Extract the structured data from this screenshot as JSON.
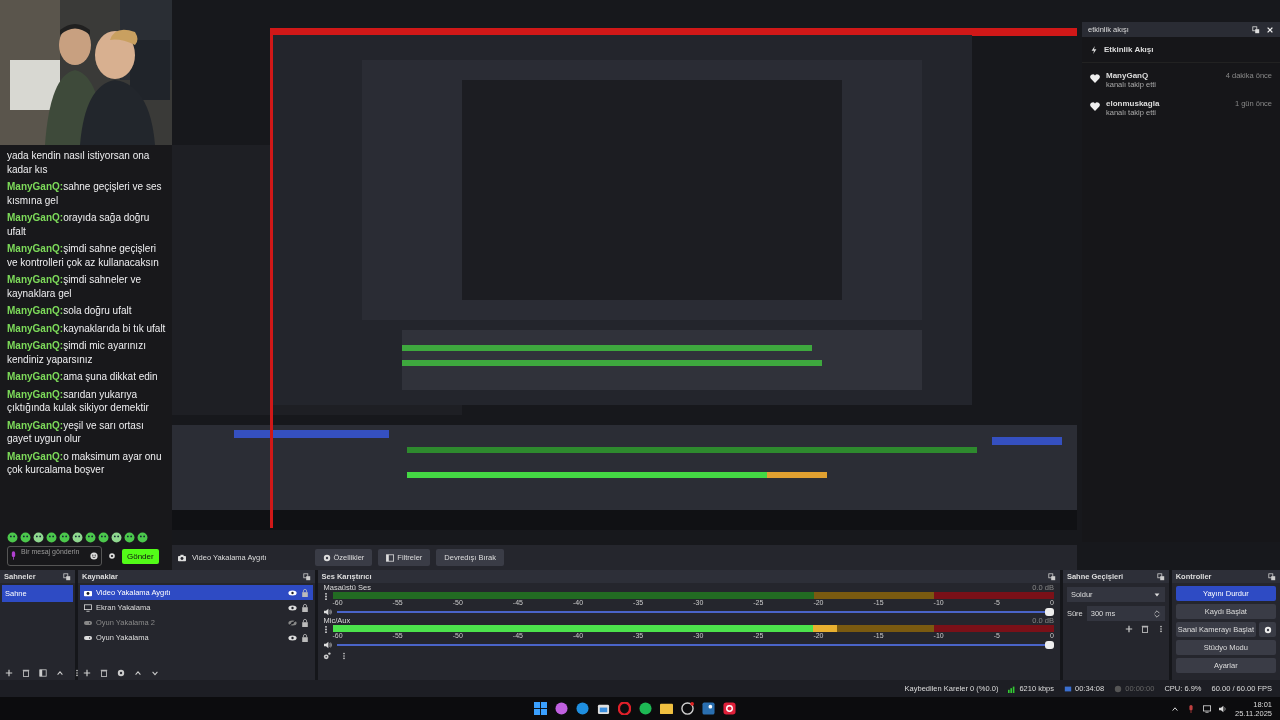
{
  "chat": {
    "messages": [
      {
        "text": "yada kendin nasıl istiyorsan ona kadar kıs"
      },
      {
        "user": "ManyGanQ:",
        "text": "sahne geçişleri ve ses kısmına gel"
      },
      {
        "user": "ManyGanQ:",
        "text": "orayıda sağa doğru ufalt"
      },
      {
        "user": "ManyGanQ:",
        "text": "şimdi sahne geçişleri ve kontrolleri çok az kullanacaksın"
      },
      {
        "user": "ManyGanQ:",
        "text": "şimdi sahneler ve kaynaklara gel"
      },
      {
        "user": "ManyGanQ:",
        "text": "sola doğru ufalt"
      },
      {
        "user": "ManyGanQ:",
        "text": "kaynaklarıda bi tık ufalt"
      },
      {
        "user": "ManyGanQ:",
        "text": "şimdi mic ayarınızı kendiniz yaparsınız"
      },
      {
        "user": "ManyGanQ:",
        "text": "ama şuna dikkat edin"
      },
      {
        "user": "ManyGanQ:",
        "text": "sarıdan yukarıya çıktığında kulak sikiyor demektir"
      },
      {
        "user": "ManyGanQ:",
        "text": "yeşil ve sarı ortası gayet uygun olur"
      },
      {
        "user": "ManyGanQ:",
        "text": "o maksimum ayar onu çok kurcalama boşver"
      }
    ],
    "input": {
      "placeholder": "Bir mesaj gönderin"
    },
    "send_button": "Gönder"
  },
  "source_toolbar": {
    "source": "Video Yakalama Aygıtı",
    "buttons": [
      "Özellikler",
      "Filtreler",
      "Devredışı Bırak"
    ]
  },
  "activity_dock": {
    "title": "etkinlik akışı",
    "heading": "Etkinlik Akışı",
    "events": [
      {
        "user": "ManyGanQ",
        "action": "kanalı takip etti",
        "time": "4 dakika önce"
      },
      {
        "user": "elonmuskagla",
        "action": "kanalı takip etti",
        "time": "1 gün önce"
      }
    ]
  },
  "scenes": {
    "title": "Sahneler",
    "items": [
      {
        "name": "Sahne",
        "selected": true
      }
    ]
  },
  "sources": {
    "title": "Kaynaklar",
    "items": [
      {
        "name": "Video Yakalama Aygıtı",
        "kind": "camera",
        "selected": true,
        "visible": true
      },
      {
        "name": "Ekran Yakalama",
        "kind": "display",
        "selected": false,
        "visible": true
      },
      {
        "name": "Oyun Yakalama 2",
        "kind": "game",
        "selected": false,
        "visible": false
      },
      {
        "name": "Oyun Yakalama",
        "kind": "game",
        "selected": false,
        "visible": true
      }
    ]
  },
  "mixer": {
    "title": "Ses Karıştırıcı",
    "channels": [
      {
        "name": "Masaüstü Ses",
        "reading": "0.0 dB",
        "meter": {
          "level": 0
        },
        "fader": {
          "level": 1
        },
        "scale": [
          "-60",
          "-55",
          "-50",
          "-45",
          "-40",
          "-35",
          "-30",
          "-25",
          "-20",
          "-15",
          "-10",
          "-5",
          "0"
        ]
      },
      {
        "name": "Mic/Aux",
        "reading": "0.0 dB",
        "meter": {
          "level": 0.7
        },
        "fader": {
          "level": 1
        },
        "scale": [
          "-60",
          "-55",
          "-50",
          "-45",
          "-40",
          "-35",
          "-30",
          "-25",
          "-20",
          "-15",
          "-10",
          "-5",
          "0"
        ]
      }
    ]
  },
  "transitions": {
    "title": "Sahne Geçişleri",
    "transition": "Soldur",
    "duration_label": "Süre",
    "duration": "300 ms"
  },
  "controls": {
    "title": "Kontroller",
    "buttons": [
      {
        "label": "Yayını Durdur",
        "active": true,
        "settings": false
      },
      {
        "label": "Kaydı Başlat",
        "active": false,
        "settings": false
      },
      {
        "label": "Sanal Kamerayı Başlat",
        "active": false,
        "settings": true
      },
      {
        "label": "Stüdyo Modu",
        "active": false,
        "settings": false
      },
      {
        "label": "Ayarlar",
        "active": false,
        "settings": false
      }
    ]
  },
  "status_bar": {
    "dropped_frames": "Kaybedilen Kareler 0 (%0.0)",
    "bitrate": "6210 kbps",
    "stream_time": "00:34:08",
    "record_time": "00:00:00",
    "cpu": "CPU: 6.9%",
    "fps": "60.00 / 60.00 FPS"
  },
  "taskbar": {
    "apps": [
      {
        "kind": "windows"
      },
      {
        "kind": "copilot"
      },
      {
        "kind": "edge"
      },
      {
        "kind": "store"
      },
      {
        "kind": "opera"
      },
      {
        "kind": "spotify"
      },
      {
        "kind": "folder"
      },
      {
        "kind": "obs"
      },
      {
        "kind": "steam"
      },
      {
        "kind": "red-app"
      }
    ],
    "time": "18:01",
    "date": "25.11.2025"
  }
}
